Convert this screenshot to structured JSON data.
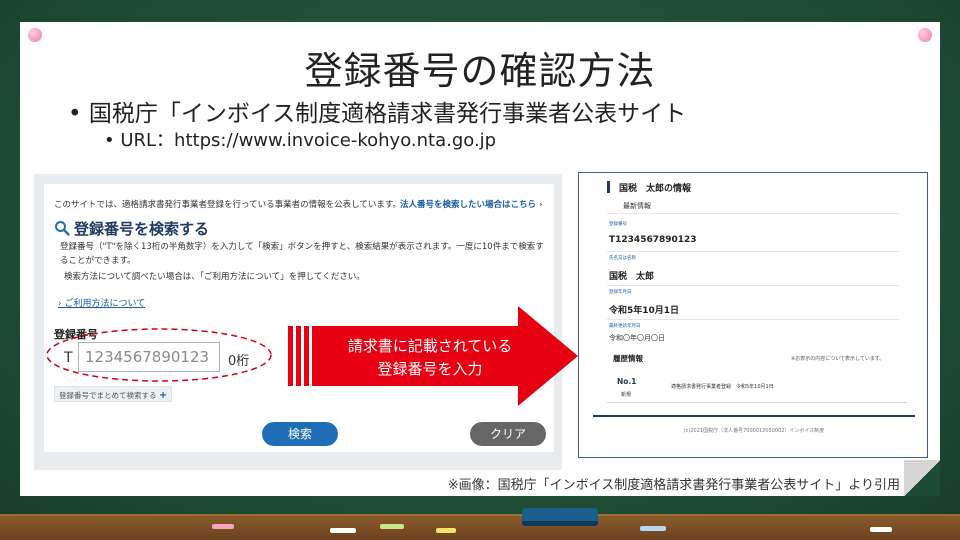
{
  "slide": {
    "title": "登録番号の確認方法",
    "bullet1": "• 国税庁「インボイス制度適格請求書発行事業者公表サイト",
    "bullet2": "• URL：https://www.invoice-kohyo.nta.go.jp",
    "caption": "※画像：国税庁「インボイス制度適格請求書発行事業者公表サイト」より引用"
  },
  "search_panel": {
    "notice": "このサイトでは、適格請求書発行事業者登録を行っている事業者の情報を公表しています。",
    "corp_link": "法人番号を検索したい場合はこちら ›",
    "heading": "登録番号を検索する",
    "description": "登録番号（\"T\"を除く13桁の半角数字）を入力して「検索」ボタンを押すと、検索結果が表示されます。一度に10件まで検索することができます。",
    "description2": "検索方法について調べたい場合は、「ご利用方法について」を押してください。",
    "guide_link": "› ご利用方法について",
    "field_label": "登録番号",
    "prefix": "T",
    "input_value": "1234567890123",
    "digit_count": "0桁",
    "bulk_label": "登録番号でまとめて検索する",
    "bulk_plus": "+",
    "search_button": "検索",
    "clear_button": "クリア"
  },
  "arrow": {
    "line1": "請求書に記載されている",
    "line2": "登録番号を入力"
  },
  "result_panel": {
    "title": "国税　太郎の情報",
    "latest": "最新情報",
    "reg_no_label": "登録番号",
    "reg_no": "T1234567890123",
    "name_label": "氏名又は名称",
    "name": "国税　太郎",
    "date_label": "登録年月日",
    "date": "令和5年10月1日",
    "updated_label": "最終更新年月日",
    "updated": "令和〇年〇月〇日",
    "history_label": "履歴情報",
    "history_note": "※お表示の内容について表示しています。",
    "history_no": "No.1",
    "history_type": "新規",
    "history_text": "適格請求書発行事業者登録　令和5年10月1日",
    "footer": "(c)2021国税庁（法人番号7000012050002）インボイス制度"
  },
  "colors": {
    "board": "#1f4d35",
    "arrow_red": "#e60012",
    "search_blue": "#1f6eb5",
    "ellipse_red": "#d0021b"
  }
}
